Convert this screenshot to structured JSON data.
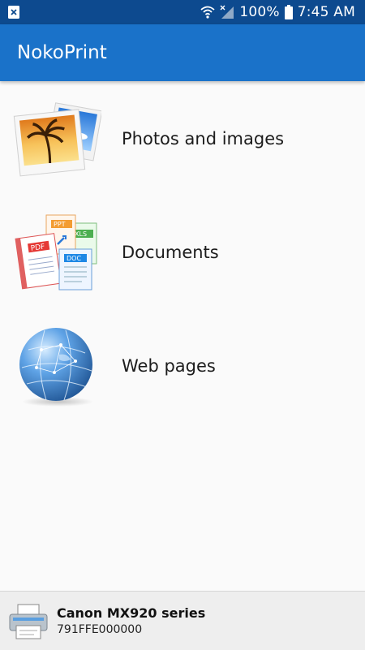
{
  "status_bar": {
    "battery_percent": "100%",
    "time": "7:45 AM",
    "icons": [
      "notification-icon",
      "wifi-icon",
      "signal-icon",
      "battery-icon"
    ]
  },
  "app_bar": {
    "title": "NokoPrint",
    "color": "#1a72c9"
  },
  "menu": {
    "items": [
      {
        "label": "Photos and images",
        "icon": "photos-icon"
      },
      {
        "label": "Documents",
        "icon": "documents-icon"
      },
      {
        "label": "Web pages",
        "icon": "globe-icon"
      }
    ]
  },
  "printer": {
    "name": "Canon MX920 series",
    "id": "791FFE000000",
    "icon": "printer-icon"
  }
}
